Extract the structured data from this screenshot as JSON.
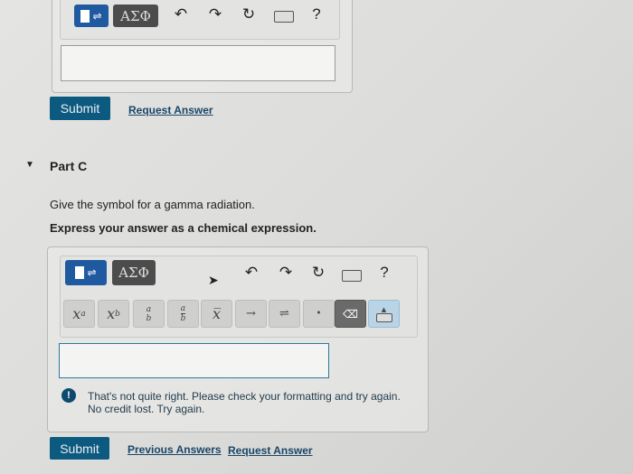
{
  "top_part": {
    "greek_label": "ΑΣΦ",
    "help": "?",
    "submit": "Submit",
    "request_answer": "Request Answer"
  },
  "part_c": {
    "title": "Part C",
    "question": "Give the symbol for a gamma radiation.",
    "instruction": "Express your answer as a chemical expression.",
    "toolbar": {
      "greek_label": "ΑΣΦ",
      "help": "?",
      "keys": [
        {
          "name": "superscript",
          "label": "x",
          "sup": "a"
        },
        {
          "name": "subscript",
          "label": "x",
          "sub": "b"
        },
        {
          "name": "stacked",
          "top": "a",
          "bottom": "b"
        },
        {
          "name": "fraction",
          "top": "a",
          "bottom": "b"
        },
        {
          "name": "overbar",
          "label": "x̅"
        },
        {
          "name": "reaction-arrow",
          "label": "→"
        },
        {
          "name": "equilibrium-arrow",
          "label": "⇌"
        },
        {
          "name": "dot",
          "label": "•"
        }
      ]
    },
    "answer_value": "",
    "feedback": {
      "line1": "That's not quite right. Please check your formatting and try again.",
      "line2": "No credit lost. Try again."
    },
    "submit": "Submit",
    "previous_answers": "Previous Answers",
    "request_answer": "Request Answer"
  },
  "colors": {
    "accent": "#1f5aa0",
    "submit": "#0d5a80",
    "link": "#1a4668"
  }
}
